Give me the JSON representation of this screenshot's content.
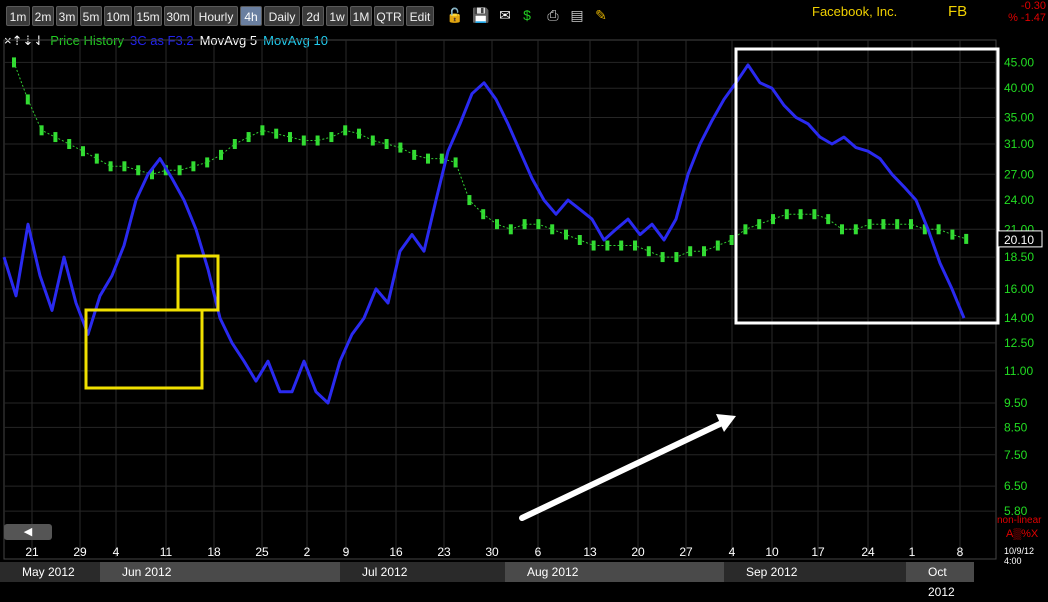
{
  "toolbar": {
    "timeframes": [
      "1m",
      "2m",
      "3m",
      "5m",
      "10m",
      "15m",
      "30m",
      "Hourly",
      "4h",
      "Daily",
      "2d",
      "1w",
      "1M",
      "QTR",
      "Edit"
    ],
    "active": "4h",
    "icons": [
      "lock-icon",
      "save-icon",
      "mail-icon",
      "dollar-icon",
      "print-icon",
      "form-icon",
      "pencil-icon"
    ]
  },
  "ticker": {
    "name": "Facebook, Inc.",
    "symbol": "FB",
    "change": "-0.30",
    "change_pct": "% -1.47"
  },
  "legend": {
    "arrows": "×⇡⇣⇃",
    "items": [
      {
        "label": "Price History",
        "color": "#22cc22"
      },
      {
        "label": "3C as F3.2",
        "color": "#2222ee"
      },
      {
        "label": "MovAvg 5",
        "color": "#ffffff"
      },
      {
        "label": "MovAvg 10",
        "color": "#22ccee"
      }
    ]
  },
  "footer": {
    "date": "10/9/12 4:00",
    "nonlinear": "non-linear",
    "scale": "A▒%X",
    "scroll": "◀"
  },
  "chart_data": {
    "type": "line",
    "price_axis": {
      "ticks": [
        "45.00",
        "40.00",
        "35.00",
        "31.00",
        "27.00",
        "24.00",
        "21.00",
        "18.50",
        "16.00",
        "14.00",
        "12.50",
        "11.00",
        "9.50",
        "8.50",
        "7.50",
        "6.50",
        "5.80"
      ],
      "scale": "log"
    },
    "last_price": "20.10",
    "x_day_labels": [
      "21",
      "29",
      "4",
      "11",
      "18",
      "25",
      "2",
      "9",
      "16",
      "23",
      "30",
      "6",
      "13",
      "20",
      "27",
      "4",
      "10",
      "17",
      "24",
      "1",
      "8"
    ],
    "months": [
      {
        "label": "May 2012",
        "shade": "dark"
      },
      {
        "label": "Jun 2012",
        "shade": "light"
      },
      {
        "label": "Jul 2012",
        "shade": "dark"
      },
      {
        "label": "Aug 2012",
        "shade": "light"
      },
      {
        "label": "Sep 2012",
        "shade": "dark"
      },
      {
        "label": "Oct 2012",
        "shade": "light"
      }
    ],
    "series": [
      {
        "name": "3C as F3.2",
        "color": "#2a2af0",
        "x": [
          0,
          2,
          4,
          6,
          8,
          10,
          12,
          14,
          16,
          18,
          20,
          22,
          24,
          26,
          28,
          30,
          32,
          34,
          36,
          38,
          40,
          42,
          44,
          46,
          48,
          50,
          52,
          54,
          56,
          58,
          60,
          62,
          64,
          66,
          68,
          70,
          72,
          74,
          76,
          78,
          80,
          82,
          84,
          86,
          88,
          90,
          92,
          94,
          96,
          98,
          100,
          102,
          104,
          106,
          108,
          110,
          112,
          114,
          116,
          118,
          120,
          122,
          124,
          126,
          128,
          130,
          132,
          134,
          136,
          138,
          140,
          142,
          144,
          146,
          148,
          150,
          152,
          154,
          156,
          158,
          160
        ],
        "y": [
          18.5,
          15.5,
          21.5,
          17,
          14.5,
          18.5,
          15,
          13,
          15.5,
          17,
          19.5,
          24,
          27,
          29,
          26.5,
          24,
          21,
          17.5,
          14,
          12.5,
          11.5,
          10.5,
          11.5,
          10,
          10,
          11.5,
          10,
          9.5,
          11.5,
          13,
          14,
          16,
          15,
          19,
          20.5,
          19,
          24,
          30,
          34,
          39,
          41,
          38,
          34,
          30,
          26.5,
          24,
          22.5,
          24,
          23,
          22,
          20,
          21,
          22,
          20.5,
          21.5,
          20,
          22,
          27,
          31,
          34.5,
          38,
          41,
          44.5,
          41,
          40,
          37,
          35,
          34,
          32,
          31,
          32,
          30.5,
          30,
          29,
          27,
          25.5,
          24,
          21,
          18,
          16,
          14
        ]
      }
    ]
  }
}
